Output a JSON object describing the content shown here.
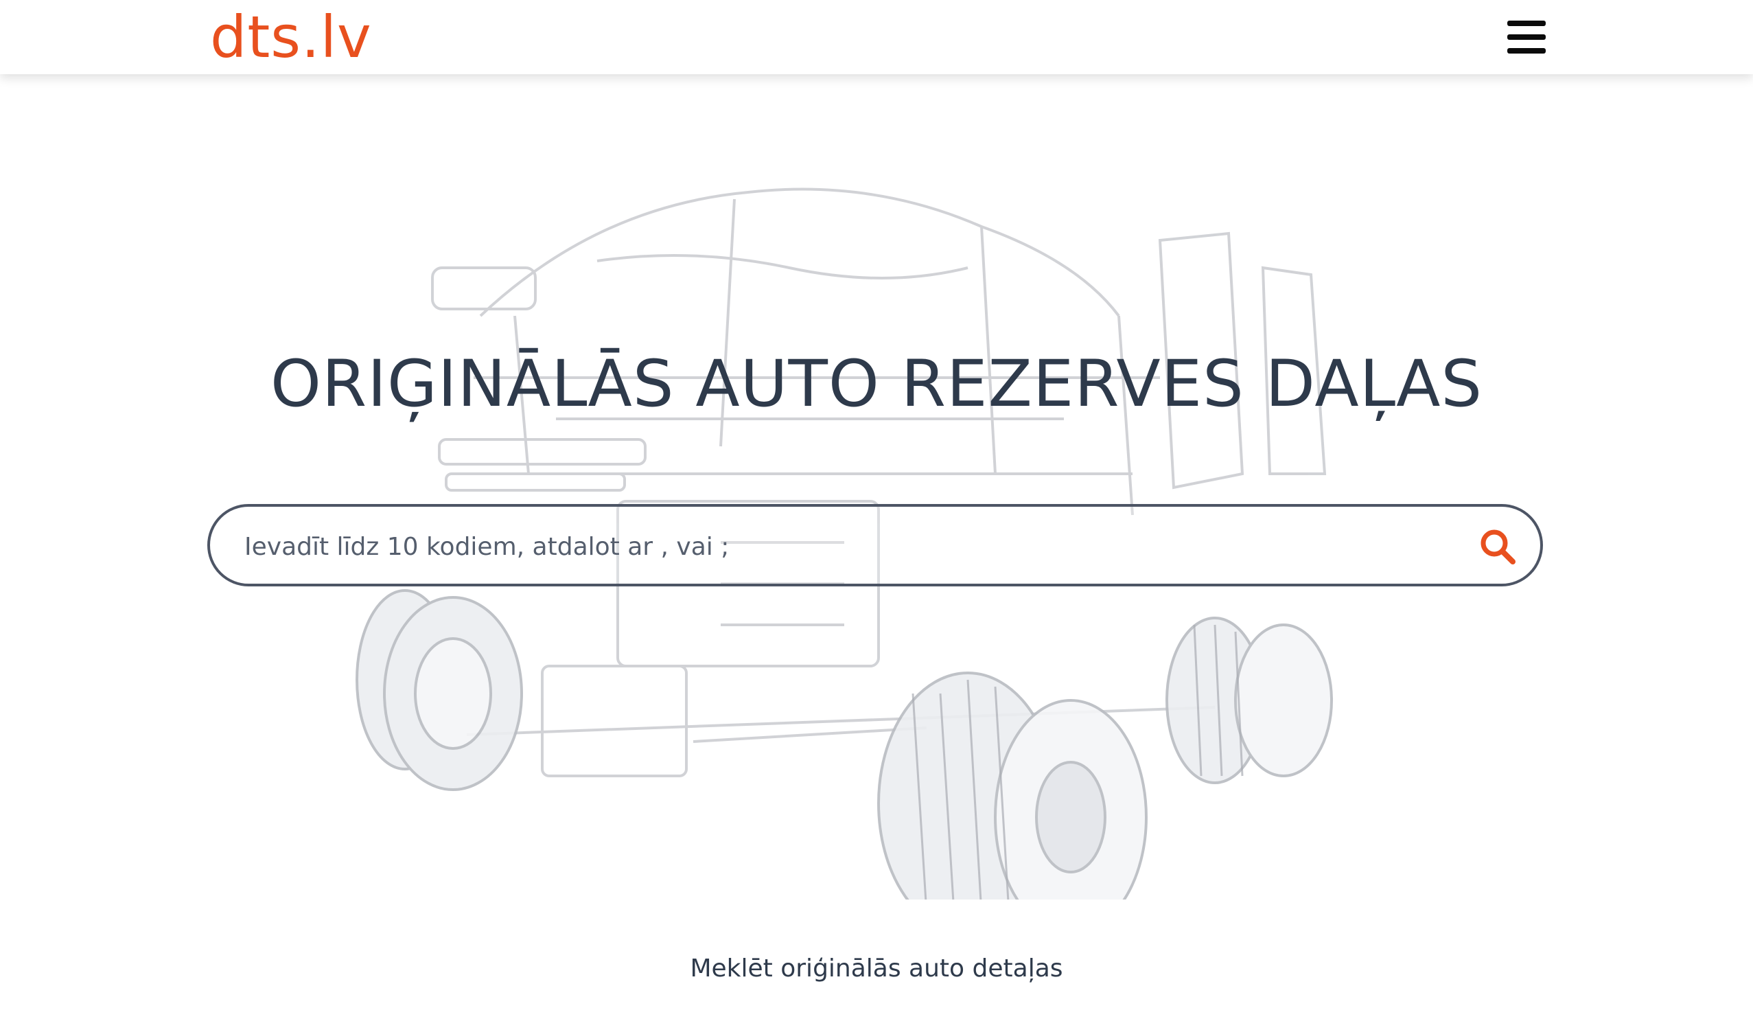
{
  "header": {
    "logo_text": "dts.lv",
    "menu_icon": "hamburger-menu-icon"
  },
  "hero": {
    "title": "ORIĢINĀLĀS AUTO REZERVES DAĻAS",
    "background_image": "exploded-car-parts-illustration"
  },
  "search": {
    "placeholder": "Ievadīt līdz 10 kodiem, atdalot ar , vai ;",
    "value": "",
    "icon": "search-icon"
  },
  "footer_text": "Meklēt oriģinālās auto detaļas",
  "colors": {
    "brand": "#e8501e",
    "title": "#2e3a4b",
    "search_border": "#4d5565"
  }
}
